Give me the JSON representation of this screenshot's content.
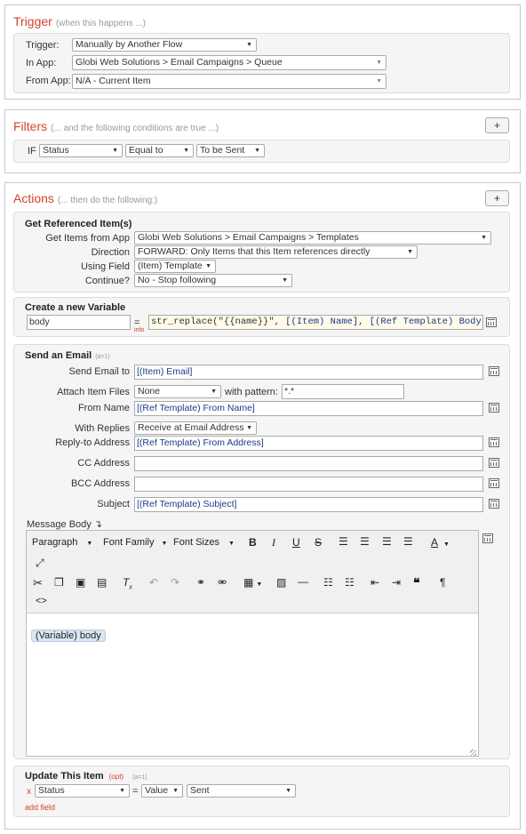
{
  "trigger": {
    "title": "Trigger",
    "subtitle": "(when this happens ...)",
    "trigger_label": "Trigger:",
    "trigger_value": "Manually by Another Flow",
    "in_app_label": "In App:",
    "in_app_value": "Globi Web Solutions > Email Campaigns > Queue",
    "from_app_label": "From App:",
    "from_app_value": "N/A - Current Item"
  },
  "filters": {
    "title": "Filters",
    "subtitle": "(... and the following conditions are true ...)",
    "add_label": "+",
    "if_label": "IF",
    "field_value": "Status",
    "operator_value": "Equal to",
    "value_value": "To be Sent"
  },
  "actions": {
    "title": "Actions",
    "subtitle": "(... then do the following:)",
    "add_label": "+",
    "get_ref": {
      "title": "Get Referenced Item(s)",
      "get_items_label": "Get Items from App",
      "get_items_value": "Globi Web Solutions > Email Campaigns > Templates",
      "direction_label": "Direction",
      "direction_value": "FORWARD: Only Items that this Item references directly",
      "using_field_label": "Using Field",
      "using_field_value": "(Item) Template",
      "continue_label": "Continue?",
      "continue_value": "No - Stop following"
    },
    "new_var": {
      "title": "Create a new Variable",
      "name_value": "body",
      "equals": "=",
      "info": "info",
      "expr_prefix": "str_replace(\"{{name}}\", ",
      "expr_token1": "[(Item) Name]",
      "expr_sep": ", ",
      "expr_token2": "[(Ref Template) Body]",
      "expr_suffix": ")"
    },
    "email": {
      "title": "Send an Email",
      "title_note": "(a=1)",
      "send_to_label": "Send Email to",
      "send_to_value": "[(Item) Email]",
      "attach_label": "Attach Item Files",
      "attach_value": "None",
      "pattern_label": "with pattern:",
      "pattern_value": "*.*",
      "from_name_label": "From Name",
      "from_name_value": "[(Ref Template) From Name]",
      "replies_label": "With Replies",
      "replies_value": "Receive at Email Address",
      "reply_to_label": "Reply-to Address",
      "reply_to_value": "[(Ref Template) From Address]",
      "cc_label": "CC Address",
      "cc_value": "",
      "bcc_label": "BCC Address",
      "bcc_value": "",
      "subject_label": "Subject",
      "subject_value": "[(Ref Template) Subject]",
      "body_label": "Message Body",
      "body_marker": "↴",
      "editor": {
        "paragraph": "Paragraph",
        "font_family": "Font Family",
        "font_sizes": "Font Sizes",
        "bold": "B",
        "italic": "I",
        "underline": "U",
        "strike": "S",
        "body_token": "(Variable) body"
      }
    },
    "update": {
      "title": "Update This Item",
      "opt": "(opt)",
      "note": "(a=1)",
      "remove": "x",
      "field_value": "Status",
      "equals": "=",
      "type_value": "Value",
      "value_value": "Sent",
      "add_field": "add field"
    }
  }
}
